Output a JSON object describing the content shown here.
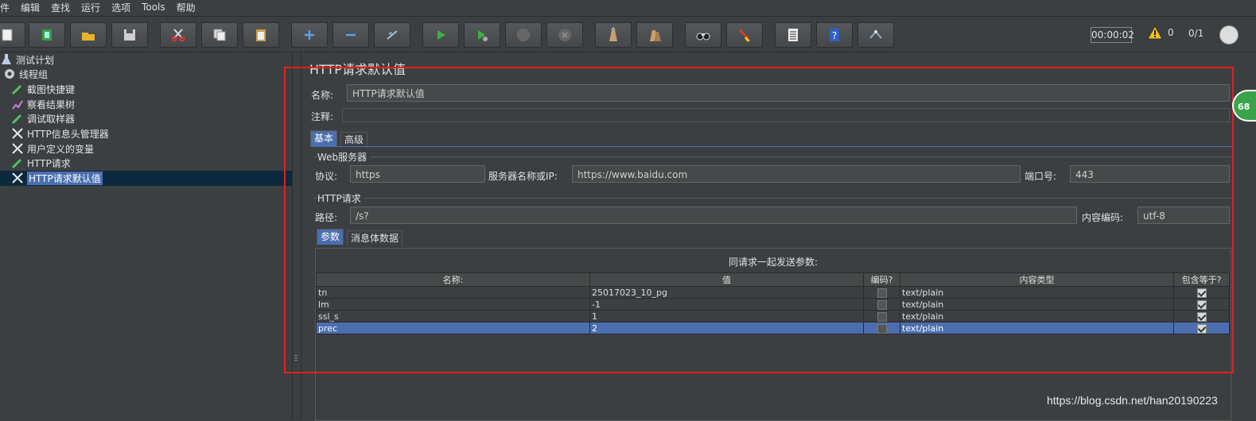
{
  "menu": [
    "件",
    "编辑",
    "查找",
    "运行",
    "选项",
    "Tools",
    "帮助"
  ],
  "toolbar": {
    "buttons": [
      {
        "name": "new-icon"
      },
      {
        "name": "templates-icon"
      },
      {
        "name": "open-icon"
      },
      {
        "name": "save-icon"
      },
      {
        "name": "cut-icon"
      },
      {
        "name": "copy-icon"
      },
      {
        "name": "paste-icon"
      },
      {
        "name": "expand-icon"
      },
      {
        "name": "collapse-icon"
      },
      {
        "name": "toggle-icon"
      },
      {
        "name": "start-icon"
      },
      {
        "name": "start-no-pause-icon"
      },
      {
        "name": "stop-icon"
      },
      {
        "name": "shutdown-icon"
      },
      {
        "name": "clear-icon"
      },
      {
        "name": "clear-all-icon"
      },
      {
        "name": "search-icon"
      },
      {
        "name": "reset-search-icon"
      },
      {
        "name": "function-helper-icon"
      },
      {
        "name": "help-icon"
      },
      {
        "name": "remote-icon"
      }
    ],
    "timer": "00:00:02",
    "warnings": "0",
    "threads": "0/1"
  },
  "tree": {
    "items": [
      {
        "label": "测试计划",
        "icon": "flask-icon"
      },
      {
        "label": "线程组",
        "icon": "gear-icon"
      },
      {
        "label": "截图快捷键",
        "icon": "pipette-icon"
      },
      {
        "label": "察看结果树",
        "icon": "chart-icon"
      },
      {
        "label": "调试取样器",
        "icon": "pipette-icon"
      },
      {
        "label": "HTTP信息头管理器",
        "icon": "wrench-icon"
      },
      {
        "label": "用户定义的变量",
        "icon": "wrench-icon"
      },
      {
        "label": "HTTP请求",
        "icon": "pipette-icon"
      },
      {
        "label": "HTTP请求默认值",
        "icon": "wrench-icon"
      }
    ]
  },
  "panel": {
    "title": "HTTP请求默认值",
    "name_label": "名称:",
    "name_value": "HTTP请求默认值",
    "comment_label": "注释:",
    "tabs": [
      "基本",
      "高级"
    ],
    "web_server": {
      "title": "Web服务器",
      "protocol_label": "协议:",
      "protocol_value": "https",
      "server_label": "服务器名称或IP:",
      "server_value": "https://www.baidu.com",
      "port_label": "端口号:",
      "port_value": "443"
    },
    "http_request": {
      "title": "HTTP请求",
      "path_label": "路径:",
      "path_value": "/s?",
      "encoding_label": "内容编码:",
      "encoding_value": "utf-8"
    },
    "param_tabs": [
      "参数",
      "消息体数据"
    ],
    "params_title": "同请求一起发送参数:",
    "params_columns": [
      "名称:",
      "值",
      "编码?",
      "内容类型",
      "包含等于?"
    ],
    "params_rows": [
      {
        "name": "tn",
        "value": "25017023_10_pg",
        "encode": false,
        "content_type": "text/plain",
        "include_equals": true
      },
      {
        "name": "lm",
        "value": "-1",
        "encode": false,
        "content_type": "text/plain",
        "include_equals": true
      },
      {
        "name": "ssl_s",
        "value": "1",
        "encode": false,
        "content_type": "text/plain",
        "include_equals": true
      },
      {
        "name": "prec",
        "value": "2",
        "encode": false,
        "content_type": "text/plain",
        "include_equals": true
      }
    ]
  },
  "side_badge": "68",
  "watermark": "https://blog.csdn.net/han20190223",
  "colors": {
    "background": "#3c3f41",
    "selection": "#4b6eaf",
    "highlight_box": "#e02020"
  }
}
